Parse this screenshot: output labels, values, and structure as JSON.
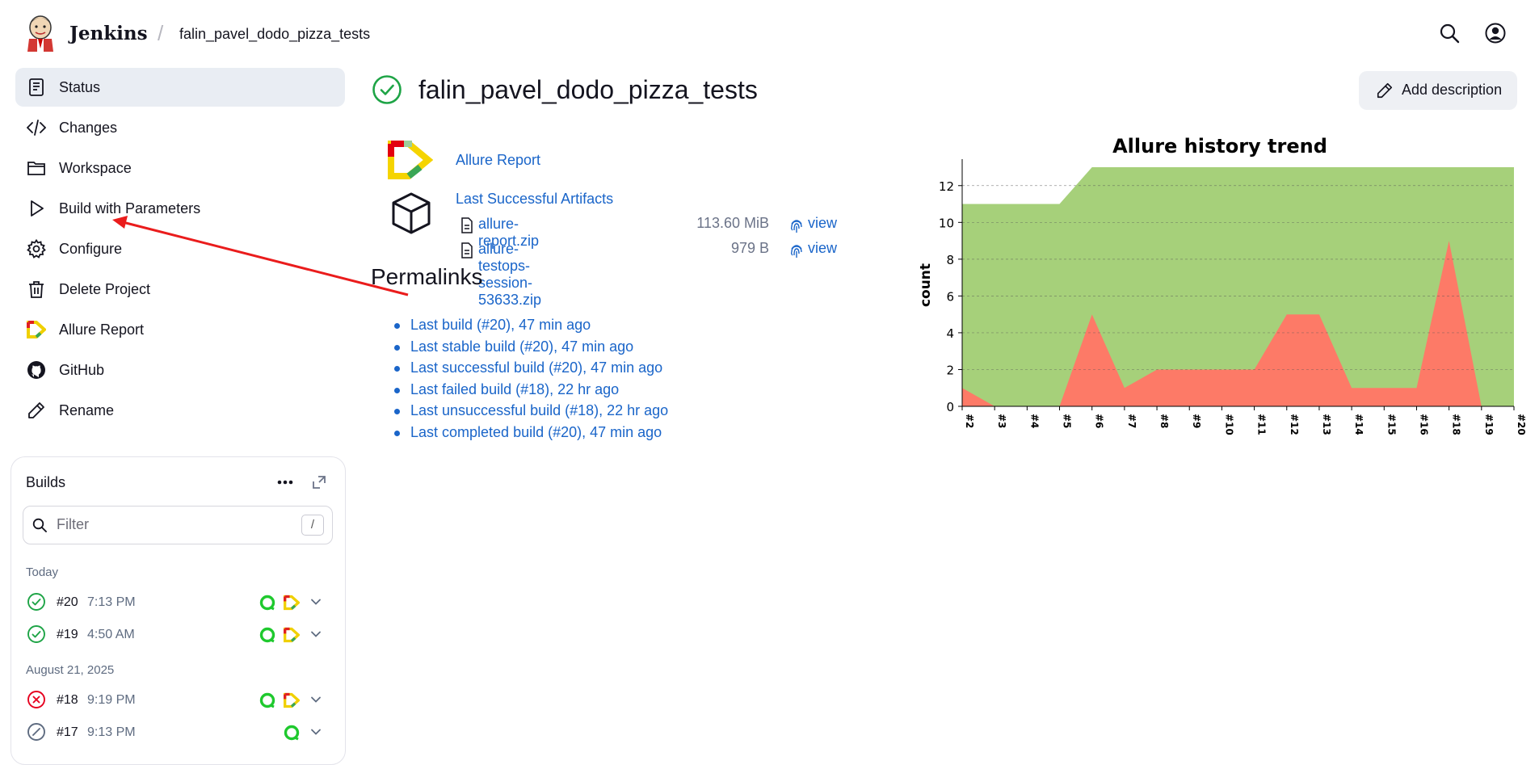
{
  "header": {
    "brand": "Jenkins",
    "separator": "/",
    "breadcrumb_job": "falin_pavel_dodo_pizza_tests",
    "icons": [
      "search-icon",
      "user-icon"
    ]
  },
  "sidebar": {
    "items": [
      {
        "label": "Status",
        "icon": "notepad-icon"
      },
      {
        "label": "Changes",
        "icon": "code-icon"
      },
      {
        "label": "Workspace",
        "icon": "folder-icon"
      },
      {
        "label": "Build with Parameters",
        "icon": "play-icon"
      },
      {
        "label": "Configure",
        "icon": "gear-icon"
      },
      {
        "label": "Delete Project",
        "icon": "trash-icon"
      },
      {
        "label": "Allure Report",
        "icon": "allure-icon"
      },
      {
        "label": "GitHub",
        "icon": "github-icon"
      },
      {
        "label": "Rename",
        "icon": "pencil-icon"
      }
    ]
  },
  "builds": {
    "title": "Builds",
    "filter_placeholder": "Filter",
    "filter_shortcut": "/",
    "groups": [
      {
        "label": "Today"
      },
      {
        "label": "August 21, 2025"
      }
    ],
    "rows": [
      {
        "number": "#20",
        "time": "7:13 PM",
        "status": "success"
      },
      {
        "number": "#19",
        "time": "4:50 AM",
        "status": "success"
      },
      {
        "number": "#18",
        "time": "9:19 PM",
        "status": "failed"
      },
      {
        "number": "#17",
        "time": "9:13 PM",
        "status": "aborted"
      }
    ]
  },
  "main": {
    "title": "falin_pavel_dodo_pizza_tests",
    "add_description": "Add description",
    "allure_report": "Allure Report",
    "last_successful_artifacts": "Last Successful Artifacts",
    "artifacts": [
      {
        "name": "allure-report.zip",
        "size": "113.60 MiB",
        "view": "view"
      },
      {
        "name": "allure-testops-session-53633.zip",
        "size": "979 B",
        "view": "view"
      }
    ],
    "permalinks_title": "Permalinks",
    "permalinks": [
      "Last build (#20), 47 min ago",
      "Last stable build (#20), 47 min ago",
      "Last successful build (#20), 47 min ago",
      "Last failed build (#18), 22 hr ago",
      "Last unsuccessful build (#18), 22 hr ago",
      "Last completed build (#20), 47 min ago"
    ]
  },
  "chart_data": {
    "type": "area",
    "title": "Allure history trend",
    "xlabel": "",
    "ylabel": "count",
    "ylim": [
      0,
      13
    ],
    "yticks": [
      0,
      2,
      4,
      6,
      8,
      10,
      12
    ],
    "grid": true,
    "categories": [
      "#2",
      "#3",
      "#4",
      "#5",
      "#6",
      "#7",
      "#8",
      "#9",
      "#10",
      "#11",
      "#12",
      "#13",
      "#14",
      "#15",
      "#16",
      "#18",
      "#19",
      "#20"
    ],
    "series": [
      {
        "color": "#a6d07a",
        "values": [
          11,
          11,
          11,
          11,
          13,
          13,
          13,
          13,
          13,
          13,
          13,
          13,
          13,
          13,
          13,
          13,
          13,
          13
        ]
      },
      {
        "color": "#fd7a67",
        "values": [
          1,
          0,
          0,
          0,
          5,
          1,
          2,
          2,
          2,
          2,
          5,
          5,
          1,
          1,
          1,
          9,
          0,
          0
        ]
      }
    ]
  }
}
